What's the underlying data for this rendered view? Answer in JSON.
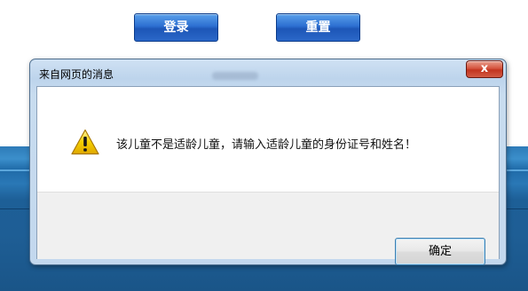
{
  "page": {
    "login_button": "登录",
    "reset_button": "重置"
  },
  "dialog": {
    "title": "来自网页的消息",
    "close_label": "x",
    "message": "该儿童不是适龄儿童，请输入适龄儿童的身份证号和姓名！",
    "ok_button": "确定",
    "icon": "warning-icon"
  },
  "colors": {
    "page_band": "#1e5e95",
    "page_button": "#2c6fd1",
    "close_button": "#c2341f",
    "warning_yellow": "#f2c200"
  }
}
